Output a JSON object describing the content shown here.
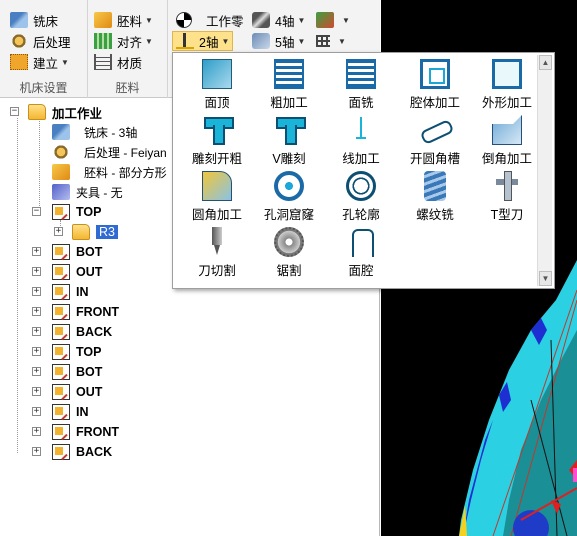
{
  "ribbon": {
    "groups": [
      {
        "title": "机床设置",
        "items": [
          {
            "label": "铣床",
            "icon": "mill-icon",
            "dropdown": false
          },
          {
            "label": "后处理",
            "icon": "post-process-icon",
            "dropdown": false
          },
          {
            "label": "建立",
            "icon": "build-icon",
            "dropdown": true
          }
        ]
      },
      {
        "title": "胚料",
        "items": [
          {
            "label": "胚料",
            "icon": "stock-icon",
            "dropdown": true
          },
          {
            "label": "对齐",
            "icon": "align-icon",
            "dropdown": true
          },
          {
            "label": "材质",
            "icon": "material-icon",
            "dropdown": false
          }
        ]
      }
    ],
    "ops": {
      "work_zero": "工作零",
      "axis4": "4轴",
      "axis5": "5轴",
      "axis2": "2轴"
    }
  },
  "tree": {
    "root": "加工作业",
    "machine": "铣床 - 3轴",
    "post": "后处理 - Feiyan",
    "stock": "胚料 - 部分方形",
    "fixture": "夹具 - 无",
    "top_folder": "TOP",
    "selected_child": "R3",
    "setups": [
      "BOT",
      "OUT",
      "IN",
      "FRONT",
      "BACK",
      "TOP",
      "BOT",
      "OUT",
      "IN",
      "FRONT",
      "BACK"
    ]
  },
  "popup": {
    "items": [
      [
        "面顶",
        "粗加工",
        "面铣",
        "腔体加工",
        "外形加工"
      ],
      [
        "雕刻开粗",
        "V雕刻",
        "线加工",
        "开圆角槽",
        "倒角加工"
      ],
      [
        "圆角加工",
        "孔洞窟窿",
        "孔轮廓",
        "螺纹铣",
        "T型刀"
      ],
      [
        "刀切割",
        "锯割",
        "面腔"
      ]
    ]
  }
}
